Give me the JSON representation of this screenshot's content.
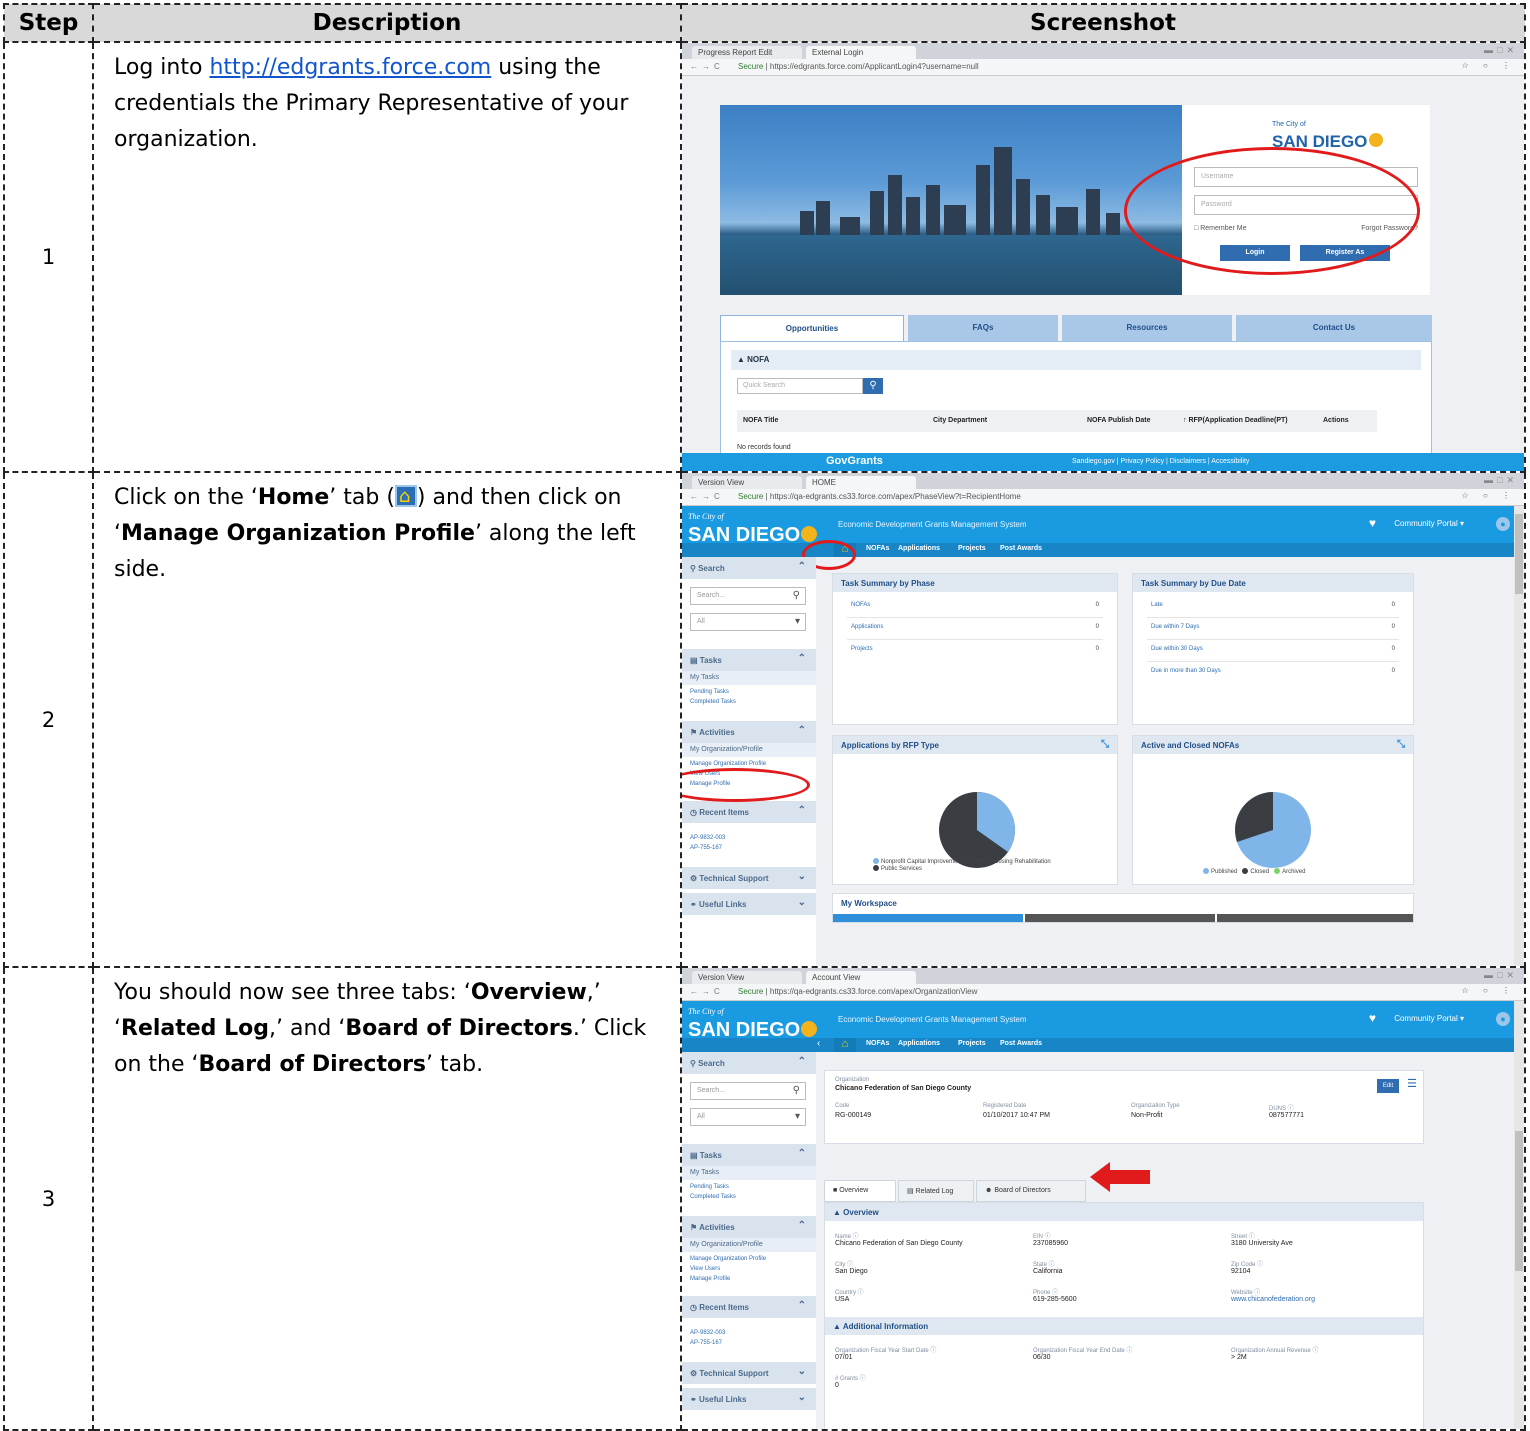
{
  "headers": {
    "step": "Step",
    "description": "Description",
    "screenshot": "Screenshot"
  },
  "steps": [
    {
      "number": "1",
      "text_pre": "Log into ",
      "link": "http://edgrants.force.com",
      "text_post": " using the credentials the Primary Representative of your organization."
    },
    {
      "number": "2",
      "p1": "Click on the ‘",
      "b1": "Home",
      "p2": "’ tab (",
      "p3": ") and then click on ‘",
      "b2": "Manage Organization Profile",
      "p4": "’ along the left side."
    },
    {
      "number": "3",
      "p1": "You should now see three tabs: ‘",
      "b1": "Overview",
      "p2": ",’ ‘",
      "b2": "Related Log",
      "p3": ",’ and ‘",
      "b3": "Board of Directors",
      "p4": ".’ Click on the ‘",
      "b4": "Board of Directors",
      "p5": "’ tab."
    }
  ],
  "shot1": {
    "tab1": "Progress Report Edit",
    "tab2": "External Login",
    "url_secure": "Secure",
    "url": "https://edgrants.force.com/ApplicantLogin4?username=null",
    "logo_cityof": "The City of",
    "logo": "SAN DIEGO",
    "username_ph": "Username",
    "password_ph": "Password",
    "remember": "Remember Me",
    "forgot": "Forgot Password?",
    "login_btn": "Login",
    "register_btn": "Register As",
    "tabs": [
      "Opportunities",
      "FAQs",
      "Resources",
      "Contact Us"
    ],
    "nofa_title": "▲ NOFA",
    "quick_search": "Quick Search",
    "cols": [
      "NOFA Title",
      "City Department",
      "NOFA Publish Date",
      "↑ RFP(Application Deadline(PT)",
      "Actions"
    ],
    "empty": "No records found",
    "footer_brand": "GovGrants",
    "footer_links": "Sandiego.gov | Privacy Policy | Disclaimers | Accessibility"
  },
  "shot2": {
    "tab1": "Version View",
    "tab2": "HOME",
    "url_secure": "Secure",
    "url": "https://qa-edgrants.cs33.force.com/apex/PhaseView?t=RecipientHome",
    "cityof": "The City of",
    "brand": "SAN DIEGO",
    "system": "Economic Development Grants Management System",
    "portal": "Community Portal ▾",
    "menu": [
      "NOFAs",
      "Applications",
      "Projects",
      "Post Awards"
    ],
    "sb_search": "Search",
    "sb_search_ph": "Search...",
    "sb_all": "All",
    "sb_tasks": "Tasks",
    "sb_mytasks": "My Tasks",
    "sb_pending": "Pending Tasks",
    "sb_completed": "Completed Tasks",
    "sb_activities": "Activities",
    "sb_myorg": "My Organization/Profile",
    "sb_manage_org": "Manage Organization Profile",
    "sb_view_users": "View Users",
    "sb_manage_profile": "Manage Profile",
    "sb_recent": "Recent Items",
    "sb_recent1": "AP-9832-003",
    "sb_recent2": "AP-755-167",
    "sb_support": "Technical Support",
    "sb_links": "Useful Links",
    "phase_title": "Task Summary by Phase",
    "phase_rows": [
      [
        "NOFAs",
        "0"
      ],
      [
        "Applications",
        "0"
      ],
      [
        "Projects",
        "0"
      ]
    ],
    "due_title": "Task Summary by Due Date",
    "due_rows": [
      [
        "Late",
        "0"
      ],
      [
        "Due within 7 Days",
        "0"
      ],
      [
        "Due within 30 Days",
        "0"
      ],
      [
        "Due in more than 30 Days",
        "0"
      ]
    ],
    "rfp_title": "Applications by RFP Type",
    "rfp_legend1": "Nonprofit Capital Improvement Projects / Housing Rehabilitation",
    "rfp_legend2": "Public Services",
    "nofa_title": "Active and Closed NOFAs",
    "nofa_legend": [
      "Published",
      "Closed",
      "Archived"
    ],
    "workspace": "My Workspace",
    "colors": {
      "blue": "#1a9ae0",
      "pie_light": "#7fb5e8",
      "pie_dark": "#3a3d42",
      "green": "#7ed36a",
      "red": "#e11b1b"
    }
  },
  "shot3": {
    "tab1": "Version View",
    "tab2": "Account View",
    "url_secure": "Secure",
    "url": "https://qa-edgrants.cs33.force.com/apex/OrganizationView",
    "org_label": "Organization",
    "org_name": "Chicano Federation of San Diego County",
    "edit": "Edit",
    "code_l": "Code",
    "code_v": "RG-000149",
    "reg_l": "Registered Date",
    "reg_v": "01/10/2017 10:47 PM",
    "type_l": "Organization Type",
    "type_v": "Non-Profit",
    "duns_l": "DUNS ⓘ",
    "duns_v": "087577771",
    "tabs": [
      "Overview",
      "Related Log",
      "Board of Directors"
    ],
    "ov_title": "▲ Overview",
    "fields": [
      [
        "Name ⓘ",
        "Chicano Federation of San Diego County"
      ],
      [
        "EIN ⓘ",
        "237085960"
      ],
      [
        "Street ⓘ",
        "3180 University Ave"
      ],
      [
        "City ⓘ",
        "San Diego"
      ],
      [
        "State ⓘ",
        "California"
      ],
      [
        "Zip Code ⓘ",
        "92104"
      ],
      [
        "Country ⓘ",
        "USA"
      ],
      [
        "Phone ⓘ",
        "619-285-5600"
      ],
      [
        "Website ⓘ",
        "www.chicanofederation.org"
      ]
    ],
    "add_title": "▲ Additional Information",
    "add_fields": [
      [
        "Organization Fiscal Year Start Date ⓘ",
        "07/01"
      ],
      [
        "Organization Fiscal Year End Date ⓘ",
        "06/30"
      ],
      [
        "Organization Annual Revenue ⓘ",
        "> 2M"
      ],
      [
        "# Grants ⓘ",
        "0"
      ]
    ]
  }
}
